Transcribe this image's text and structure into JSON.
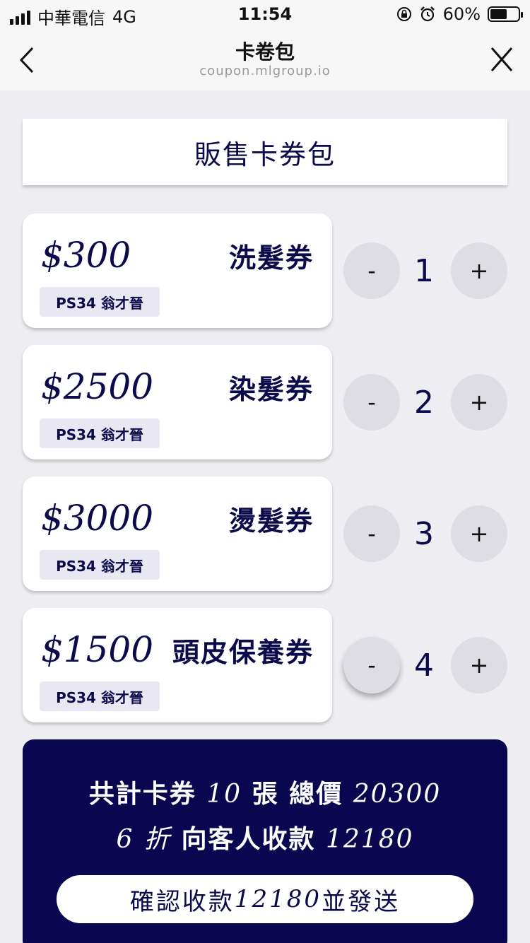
{
  "status_bar": {
    "carrier": "中華電信",
    "network": "4G",
    "time": "11:54",
    "battery": "60%",
    "battery_level": 0.6
  },
  "nav": {
    "title": "卡卷包",
    "url": "coupon.mlgroup.io"
  },
  "header": {
    "title": "販售卡券包"
  },
  "coupons": [
    {
      "price": "$300",
      "name": "洗髮券",
      "tag": "PS34 翁才晉",
      "qty": "1",
      "minus": "-",
      "plus": "+"
    },
    {
      "price": "$2500",
      "name": "染髮券",
      "tag": "PS34 翁才晉",
      "qty": "2",
      "minus": "-",
      "plus": "+"
    },
    {
      "price": "$3000",
      "name": "燙髮券",
      "tag": "PS34 翁才晉",
      "qty": "3",
      "minus": "-",
      "plus": "+"
    },
    {
      "price": "$1500",
      "name": "頭皮保養券",
      "tag": "PS34 翁才晉",
      "qty": "4",
      "minus": "-",
      "plus": "+"
    }
  ],
  "summary": {
    "count_prefix": "共計卡券",
    "count": "10",
    "count_unit": "張",
    "total_label": "總價",
    "total": "20300",
    "discount": "6",
    "discount_label": "折",
    "collect_label": "向客人收款",
    "collect": "12180",
    "confirm_prefix": "確認收款",
    "confirm_amount": "12180",
    "confirm_suffix": "並發送"
  },
  "colors": {
    "navy": "#0b0650",
    "text_navy": "#0c0a4a",
    "background": "#eeeef2",
    "button_gray": "#dedde3"
  }
}
